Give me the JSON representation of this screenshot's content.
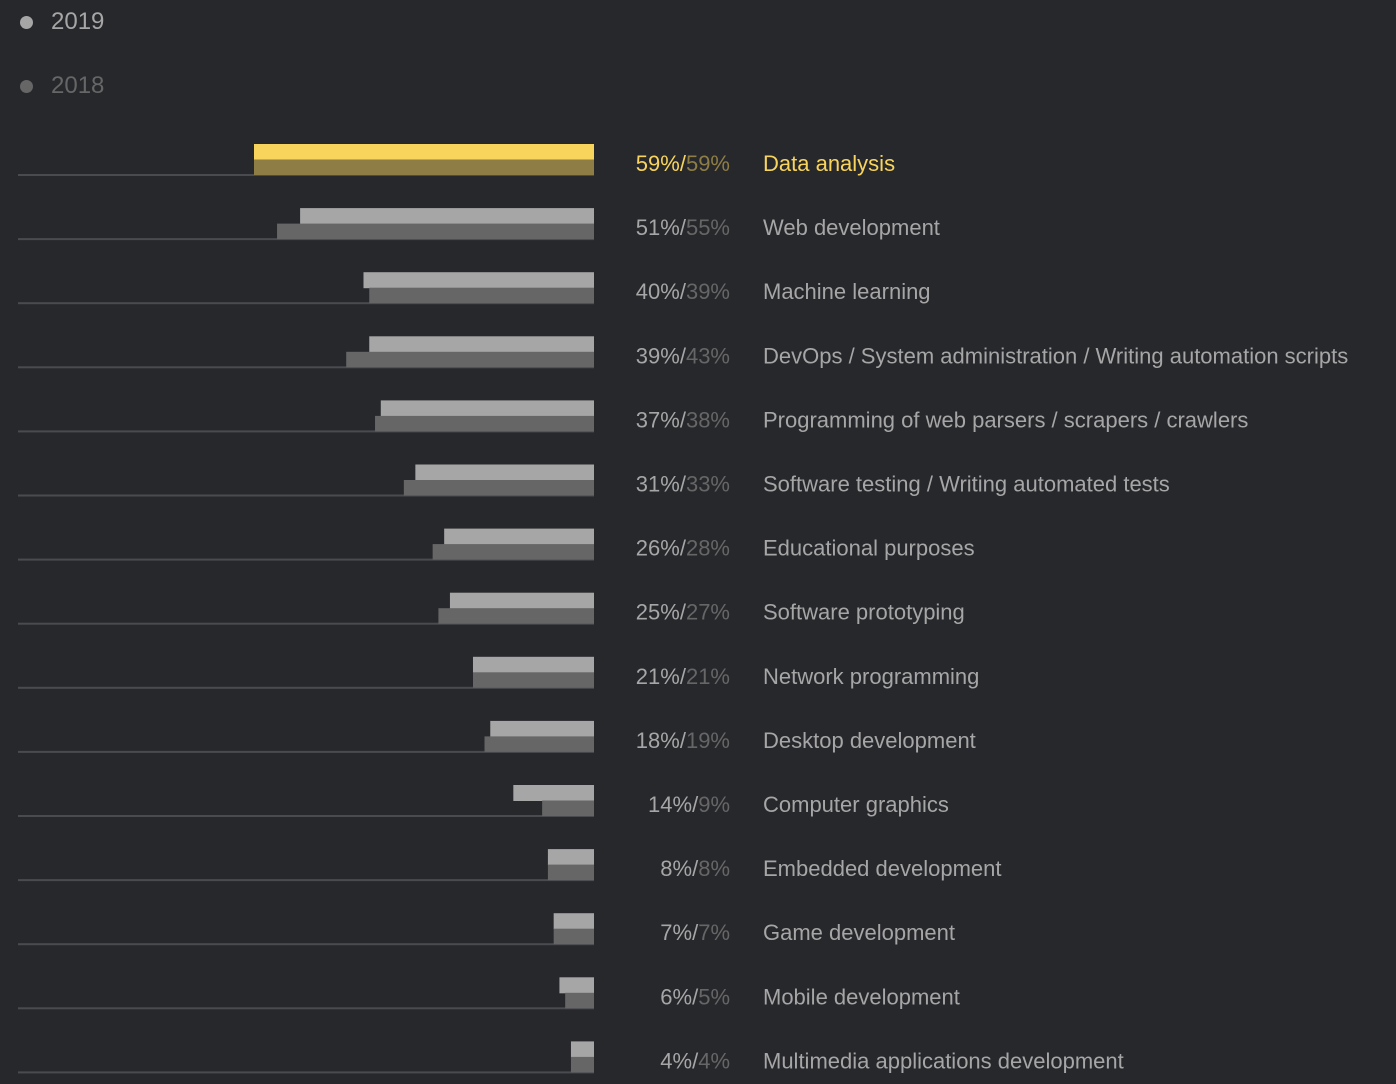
{
  "legend": {
    "items": [
      {
        "label": "2019",
        "color": "#a6a6a6"
      },
      {
        "label": "2018",
        "color": "#666666"
      }
    ]
  },
  "colors": {
    "background": "#27282c",
    "series_2019": "#a6a6a6",
    "series_2018": "#666666",
    "highlight_2019": "#f8d45c",
    "highlight_2018": "#8e7d45",
    "baseline": "#4a4b50",
    "label_text": "#a6a6a6",
    "pct_2018_text": "#666666"
  },
  "chart_data": {
    "type": "bar",
    "orientation": "horizontal",
    "title": "",
    "xlabel": "",
    "ylabel": "",
    "xlim": [
      0,
      100
    ],
    "grid": false,
    "legend_position": "top-left",
    "highlighted_category": "Data analysis",
    "categories": [
      "Data analysis",
      "Web development",
      "Machine learning",
      "DevOps / System administration / Writing automation scripts",
      "Programming of web parsers / scrapers / crawlers",
      "Software testing / Writing automated tests",
      "Educational purposes",
      "Software prototyping",
      "Network programming",
      "Desktop development",
      "Computer graphics",
      "Embedded development",
      "Game development",
      "Mobile development",
      "Multimedia applications development"
    ],
    "series": [
      {
        "name": "2019",
        "values": [
          59,
          51,
          40,
          39,
          37,
          31,
          26,
          25,
          21,
          18,
          14,
          8,
          7,
          6,
          4
        ]
      },
      {
        "name": "2018",
        "values": [
          59,
          55,
          39,
          43,
          38,
          33,
          28,
          27,
          21,
          19,
          9,
          8,
          7,
          5,
          4
        ]
      }
    ],
    "value_labels": [
      {
        "v2019": "59%",
        "v2018": "59%"
      },
      {
        "v2019": "51%",
        "v2018": "55%"
      },
      {
        "v2019": "40%",
        "v2018": "39%"
      },
      {
        "v2019": "39%",
        "v2018": "43%"
      },
      {
        "v2019": "37%",
        "v2018": "38%"
      },
      {
        "v2019": "31%",
        "v2018": "33%"
      },
      {
        "v2019": "26%",
        "v2018": "28%"
      },
      {
        "v2019": "25%",
        "v2018": "27%"
      },
      {
        "v2019": "21%",
        "v2018": "21%"
      },
      {
        "v2019": "18%",
        "v2018": "19%"
      },
      {
        "v2019": "14%",
        "v2018": "9%"
      },
      {
        "v2019": "8%",
        "v2018": "8%"
      },
      {
        "v2019": "7%",
        "v2018": "7%"
      },
      {
        "v2019": "6%",
        "v2018": "5%"
      },
      {
        "v2019": "4%",
        "v2018": "4%"
      }
    ],
    "separator": "/"
  }
}
